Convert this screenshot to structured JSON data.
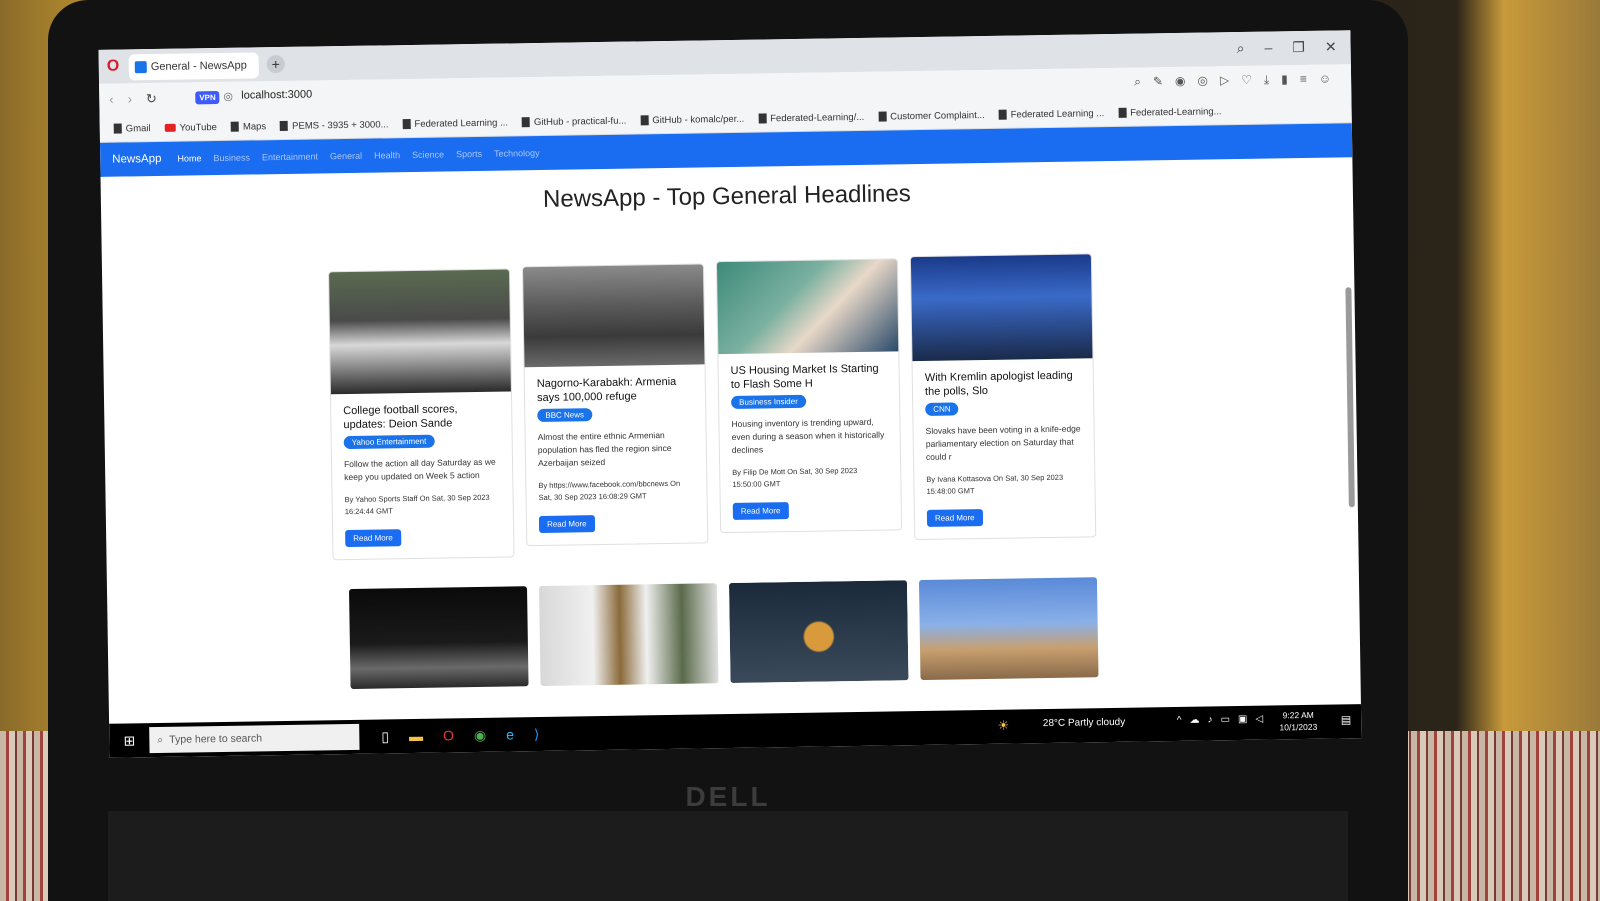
{
  "browser": {
    "tab_title": "General - NewsApp",
    "url": "localhost:3000",
    "vpn_badge": "VPN",
    "bookmarks": [
      "Gmail",
      "YouTube",
      "Maps",
      "PEMS - 3935 + 3000...",
      "Federated Learning ...",
      "GitHub - practical-fu...",
      "GitHub - komalc/per...",
      "Federated-Learning/...",
      "Customer Complaint...",
      "Federated Learning ...",
      "Federated-Learning..."
    ]
  },
  "navbar": {
    "brand": "NewsApp",
    "links": [
      "Home",
      "Business",
      "Entertainment",
      "General",
      "Health",
      "Science",
      "Sports",
      "Technology"
    ]
  },
  "page_title": "NewsApp - Top General Headlines",
  "cards": [
    {
      "title": "College football scores, updates: Deion Sande",
      "source": "Yahoo Entertainment",
      "desc": "Follow the action all day Saturday as we keep you updated on Week 5 action",
      "meta": "By Yahoo Sports Staff On Sat, 30 Sep 2023 16:24:44 GMT",
      "button": "Read More"
    },
    {
      "title": "Nagorno-Karabakh: Armenia says 100,000 refuge",
      "source": "BBC News",
      "desc": "Almost the entire ethnic Armenian population has fled the region since Azerbaijan seized",
      "meta": "By https://www.facebook.com/bbcnews On Sat, 30 Sep 2023 16:08:29 GMT",
      "button": "Read More"
    },
    {
      "title": "US Housing Market Is Starting to Flash Some H",
      "source": "Business Insider",
      "desc": "Housing inventory is trending upward, even during a season when it historically declines",
      "meta": "By Filip De Mott On Sat, 30 Sep 2023 15:50:00 GMT",
      "button": "Read More"
    },
    {
      "title": "With Kremlin apologist leading the polls, Slo",
      "source": "CNN",
      "desc": "Slovaks have been voting in a knife-edge parliamentary election on Saturday that could r",
      "meta": "By Ivana Kottasova On Sat, 30 Sep 2023 15:48:00 GMT",
      "button": "Read More"
    }
  ],
  "taskbar": {
    "search_placeholder": "Type here to search",
    "weather": "28°C Partly cloudy",
    "time": "9:22 AM",
    "date": "10/1/2023"
  },
  "laptop_brand": "DELL",
  "colors": {
    "navbar": "#1a6cf0",
    "badge": "#1a73e8",
    "button": "#1a6cf0"
  }
}
